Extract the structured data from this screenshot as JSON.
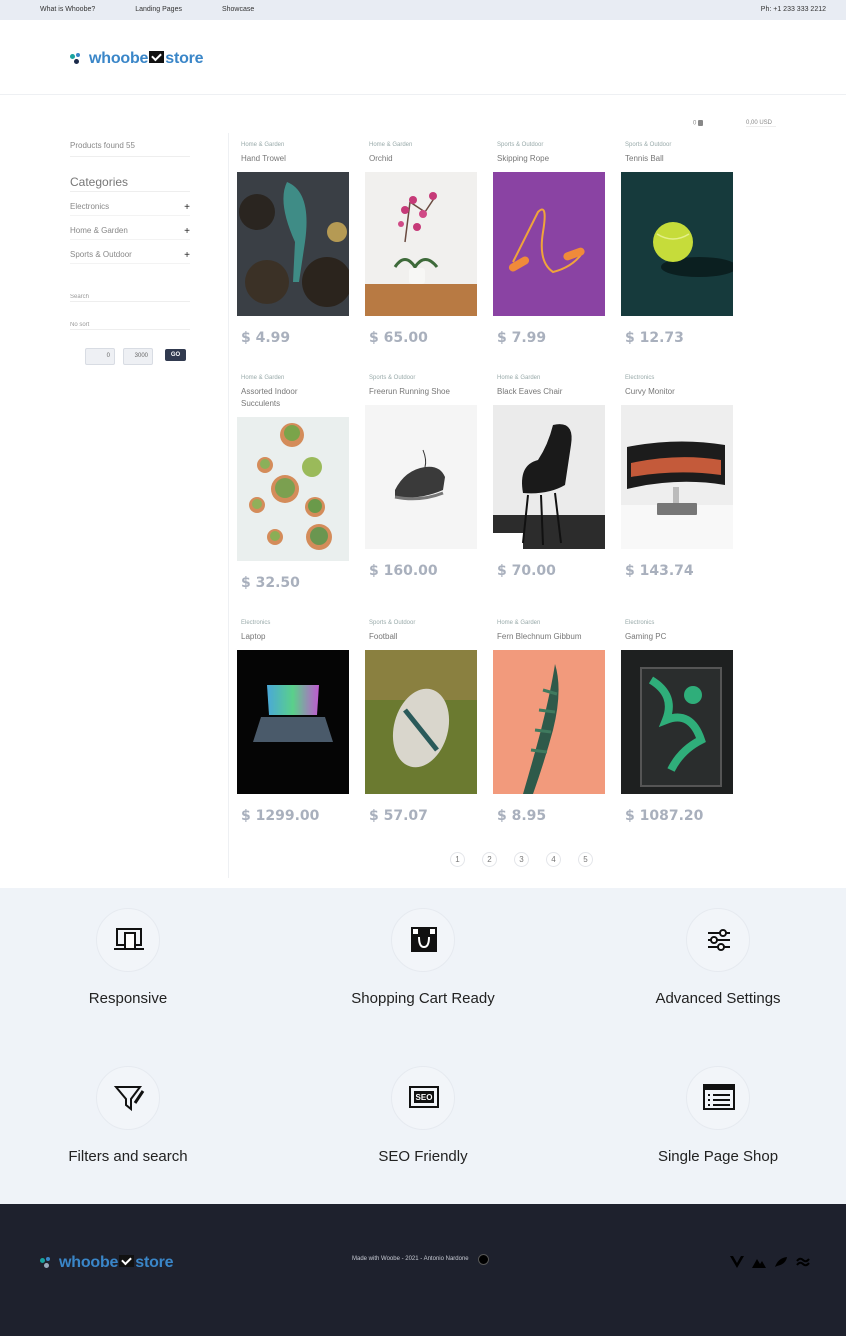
{
  "topbar": {
    "links": [
      "What is Whoobe?",
      "Landing Pages",
      "Showcase"
    ],
    "phone": "Ph: +1 233 333 2212"
  },
  "brand": {
    "name_left": "whoobe",
    "name_right": "store",
    "color": "#3a86c8"
  },
  "cart": {
    "count": "0",
    "total": "0,00 USD"
  },
  "sidebar": {
    "found": "Products found 55",
    "categories_title": "Categories",
    "categories": [
      {
        "label": "Electronics",
        "toggle": "+"
      },
      {
        "label": "Home & Garden",
        "toggle": "+"
      },
      {
        "label": "Sports & Outdoor",
        "toggle": "+"
      }
    ],
    "search_placeholder": "Search",
    "sort_placeholder": "No sort",
    "price_min": "0",
    "price_max": "3000",
    "go_label": "GO"
  },
  "products": [
    {
      "category": "Home & Garden",
      "name": "Hand Trowel",
      "price": "$ 4.99",
      "img_color": "#2e3338"
    },
    {
      "category": "Home & Garden",
      "name": "Orchid",
      "price": "$ 65.00",
      "img_color": "#f2f1ef"
    },
    {
      "category": "Sports & Outdoor",
      "name": "Skipping Rope",
      "price": "$ 7.99",
      "img_color": "#8a43a3"
    },
    {
      "category": "Sports & Outdoor",
      "name": "Tennis Ball",
      "price": "$ 12.73",
      "img_color": "#163a3c"
    },
    {
      "category": "Home & Garden",
      "name": "Assorted Indoor Succulents",
      "price": "$ 32.50",
      "img_color": "#eaefee"
    },
    {
      "category": "Sports & Outdoor",
      "name": "Freerun Running Shoe",
      "price": "$ 160.00",
      "img_color": "#f4f4f4"
    },
    {
      "category": "Home & Garden",
      "name": "Black Eaves Chair",
      "price": "$ 70.00",
      "img_color": "#e9e9e9"
    },
    {
      "category": "Electronics",
      "name": "Curvy Monitor",
      "price": "$ 143.74",
      "img_color": "#efefef"
    },
    {
      "category": "Electronics",
      "name": "Laptop",
      "price": "$ 1299.00",
      "img_color": "#050505"
    },
    {
      "category": "Sports & Outdoor",
      "name": "Football",
      "price": "$ 57.07",
      "img_color": "#5a6a2c"
    },
    {
      "category": "Home & Garden",
      "name": "Fern Blechnum Gibbum",
      "price": "$ 8.95",
      "img_color": "#f29a7c"
    },
    {
      "category": "Electronics",
      "name": "Gaming PC",
      "price": "$ 1087.20",
      "img_color": "#1a1c1c"
    }
  ],
  "pagination": [
    "1",
    "2",
    "3",
    "4",
    "5"
  ],
  "features": [
    {
      "icon": "devices-icon",
      "label": "Responsive"
    },
    {
      "icon": "shopping-bag-icon",
      "label": "Shopping Cart Ready"
    },
    {
      "icon": "sliders-icon",
      "label": "Advanced Settings"
    },
    {
      "icon": "filter-icon",
      "label": "Filters and search"
    },
    {
      "icon": "seo-icon",
      "label": "SEO Friendly"
    },
    {
      "icon": "browser-list-icon",
      "label": "Single Page Shop"
    }
  ],
  "footer": {
    "made": "Made with Woobe - 2021 - Antonio Nardone",
    "socials": [
      "vue-icon",
      "nuxt-icon",
      "feather-icon",
      "tailwind-icon"
    ]
  }
}
